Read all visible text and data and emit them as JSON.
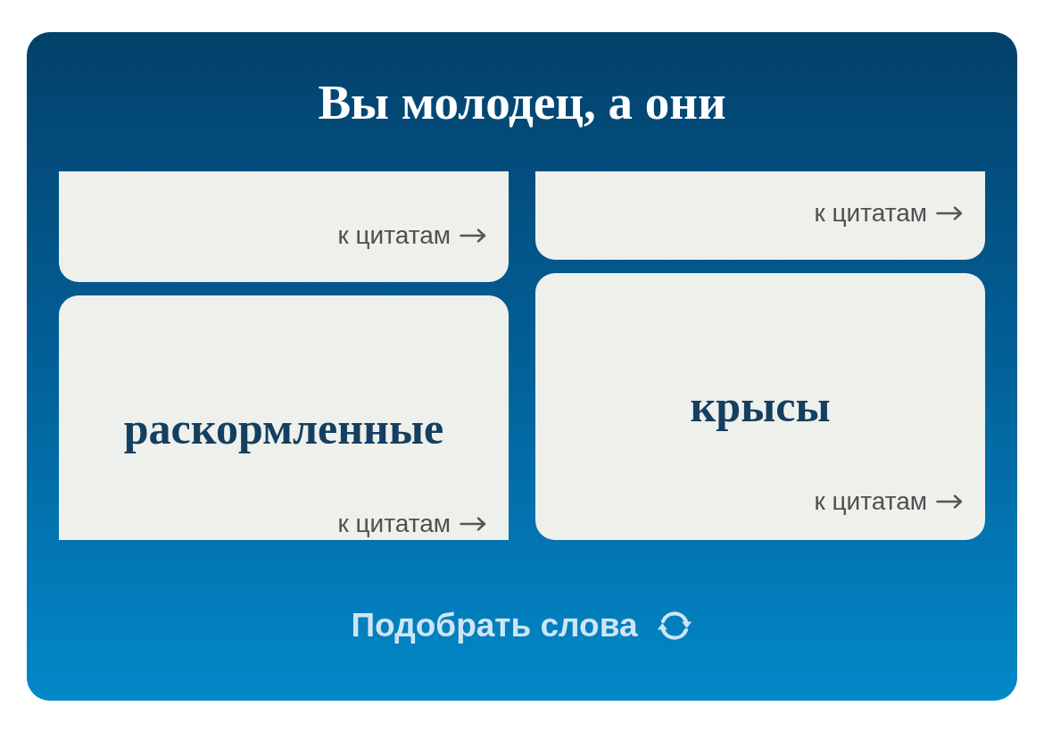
{
  "title": "Вы молодец, а они",
  "columns": [
    {
      "cards": [
        {
          "link": "к цитатам"
        },
        {
          "word": "раскормленные",
          "link": "к цитатам"
        }
      ]
    },
    {
      "cards": [
        {
          "link": "к цитатам"
        },
        {
          "word": "крысы",
          "link": "к цитатам"
        }
      ]
    }
  ],
  "button": {
    "label": "Подобрать слова"
  }
}
